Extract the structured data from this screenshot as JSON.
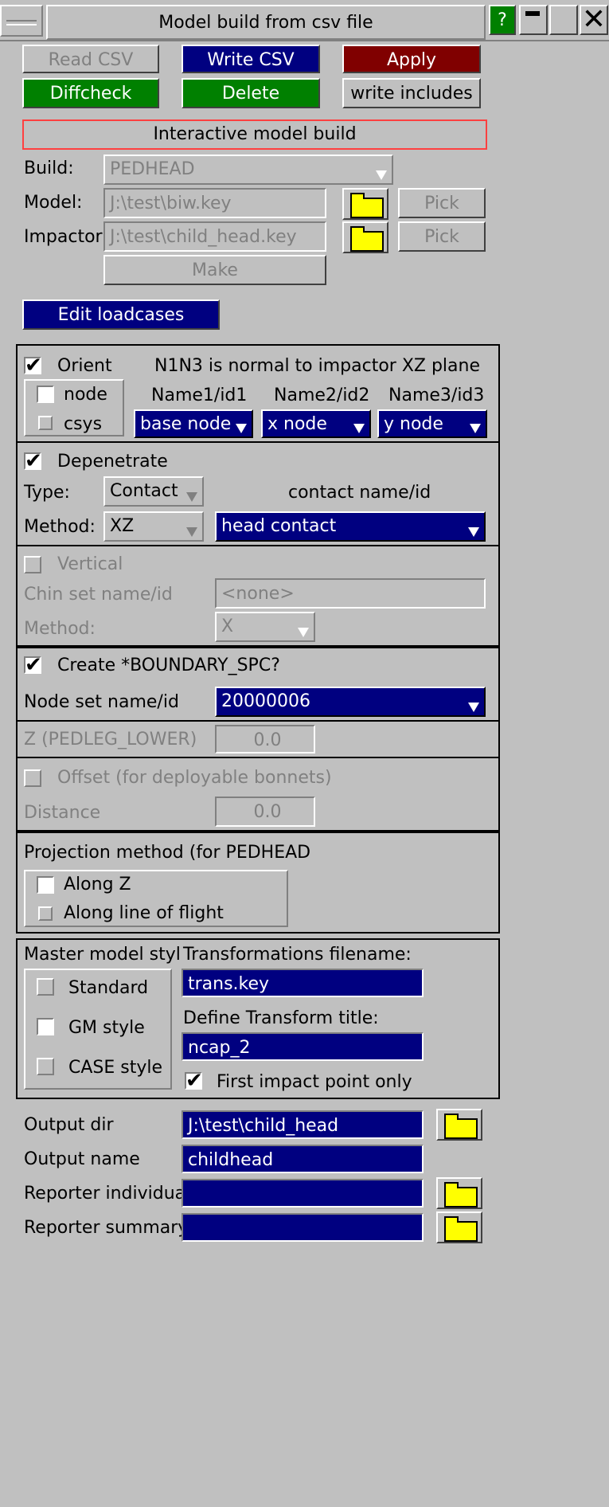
{
  "window": {
    "title": "Model build from csv file",
    "help": "?"
  },
  "toolbar": {
    "read_csv": "Read CSV",
    "write_csv": "Write CSV",
    "apply": "Apply",
    "diffcheck": "Diffcheck",
    "delete": "Delete",
    "write_includes": "write includes"
  },
  "interactive": {
    "header": "Interactive model build",
    "build_label": "Build:",
    "build_value": "PEDHEAD",
    "model_label": "Model:",
    "model_value": "J:\\test\\biw.key",
    "impactor_label": "Impactor:",
    "impactor_value": "J:\\test\\child_head.key",
    "pick": "Pick",
    "make": "Make",
    "edit_loadcases": "Edit loadcases"
  },
  "orient": {
    "label": "Orient",
    "note": "N1N3 is normal to impactor XZ plane",
    "node": "node",
    "csys": "csys",
    "name1": "Name1/id1",
    "name2": "Name2/id2",
    "name3": "Name3/id3",
    "sel1": "base node",
    "sel2": "x node",
    "sel3": "y node"
  },
  "depenetrate": {
    "label": "Depenetrate",
    "type_label": "Type:",
    "type_value": "Contact",
    "contact_header": "contact name/id",
    "method_label": "Method:",
    "method_value": "XZ",
    "contact_value": "head contact"
  },
  "vertical": {
    "label": "Vertical",
    "chin_label": "Chin set name/id",
    "chin_value": "<none>",
    "method_label": "Method:",
    "method_value": "X"
  },
  "boundary": {
    "label": "Create *BOUNDARY_SPC?",
    "node_set_label": "Node set name/id",
    "node_set_value": "20000006"
  },
  "pedleg": {
    "label": "Z (PEDLEG_LOWER)",
    "value": "0.0"
  },
  "offset": {
    "label": "Offset (for deployable bonnets)",
    "distance_label": "Distance",
    "distance_value": "0.0"
  },
  "projection": {
    "label": "Projection method (for PEDHEAD",
    "along_z": "Along Z",
    "along_flight": "Along line of flight"
  },
  "master": {
    "label": "Master model styl",
    "standard": "Standard",
    "gm": "GM style",
    "case": "CASE style",
    "trans_label": "Transformations filename:",
    "trans_value": "trans.key",
    "title_label": "Define Transform title:",
    "title_value": "ncap_2",
    "first_impact": "First impact point only"
  },
  "output": {
    "dir_label": "Output dir",
    "dir_value": "J:\\test\\child_head",
    "name_label": "Output name",
    "name_value": "childhead",
    "rep_ind_label": "Reporter individual",
    "rep_ind_value": "",
    "rep_sum_label": "Reporter summary",
    "rep_sum_value": ""
  },
  "colors": {
    "bg": "#c0c0c0",
    "navy": "#000080",
    "green": "#008000",
    "maroon": "#800000",
    "folder": "#ffff00"
  }
}
